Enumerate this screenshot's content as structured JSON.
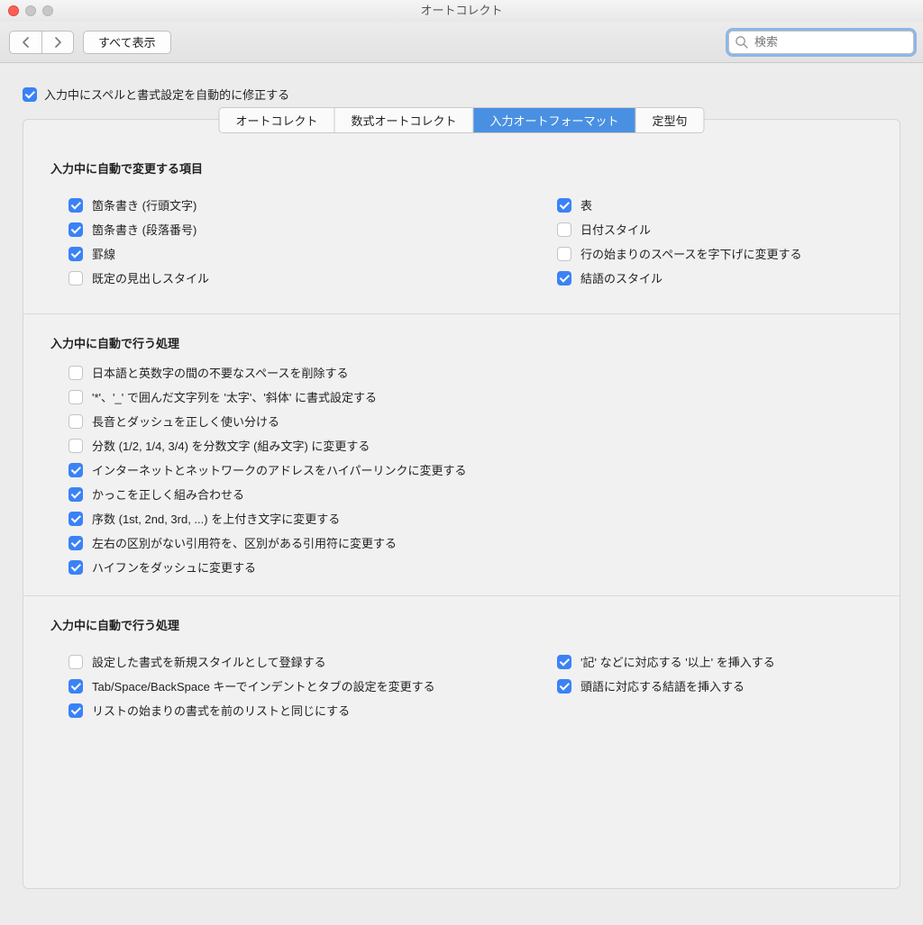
{
  "window": {
    "title": "オートコレクト"
  },
  "toolbar": {
    "show_all_label": "すべて表示",
    "search_placeholder": "検索"
  },
  "master_checkbox": {
    "label": "入力中にスペルと書式設定を自動的に修正する",
    "checked": true
  },
  "tabs": [
    {
      "label": "オートコレクト",
      "active": false
    },
    {
      "label": "数式オートコレクト",
      "active": false
    },
    {
      "label": "入力オートフォーマット",
      "active": true
    },
    {
      "label": "定型句",
      "active": false
    }
  ],
  "section1": {
    "title": "入力中に自動で変更する項目",
    "left": [
      {
        "label": "箇条書き (行頭文字)",
        "checked": true
      },
      {
        "label": "箇条書き (段落番号)",
        "checked": true
      },
      {
        "label": "罫線",
        "checked": true
      },
      {
        "label": "既定の見出しスタイル",
        "checked": false
      }
    ],
    "right": [
      {
        "label": "表",
        "checked": true
      },
      {
        "label": "日付スタイル",
        "checked": false
      },
      {
        "label": "行の始まりのスペースを字下げに変更する",
        "checked": false
      },
      {
        "label": "結語のスタイル",
        "checked": true
      }
    ]
  },
  "section2": {
    "title": "入力中に自動で行う処理",
    "items": [
      {
        "label": "日本語と英数字の間の不要なスペースを削除する",
        "checked": false
      },
      {
        "label": "'*'、'_' で囲んだ文字列を '太字'、'斜体' に書式設定する",
        "checked": false
      },
      {
        "label": "長音とダッシュを正しく使い分ける",
        "checked": false
      },
      {
        "label": "分数 (1/2, 1/4, 3/4) を分数文字 (組み文字) に変更する",
        "checked": false
      },
      {
        "label": "インターネットとネットワークのアドレスをハイパーリンクに変更する",
        "checked": true
      },
      {
        "label": "かっこを正しく組み合わせる",
        "checked": true
      },
      {
        "label": "序数 (1st, 2nd, 3rd, ...) を上付き文字に変更する",
        "checked": true
      },
      {
        "label": "左右の区別がない引用符を、区別がある引用符に変更する",
        "checked": true
      },
      {
        "label": "ハイフンをダッシュに変更する",
        "checked": true
      }
    ]
  },
  "section3": {
    "title": "入力中に自動で行う処理",
    "left": [
      {
        "label": "設定した書式を新規スタイルとして登録する",
        "checked": false
      },
      {
        "label": "Tab/Space/BackSpace キーでインデントとタブの設定を変更する",
        "checked": true
      },
      {
        "label": "リストの始まりの書式を前のリストと同じにする",
        "checked": true
      }
    ],
    "right": [
      {
        "label": "'記' などに対応する '以上' を挿入する",
        "checked": true
      },
      {
        "label": "頭語に対応する結語を挿入する",
        "checked": true
      }
    ]
  }
}
